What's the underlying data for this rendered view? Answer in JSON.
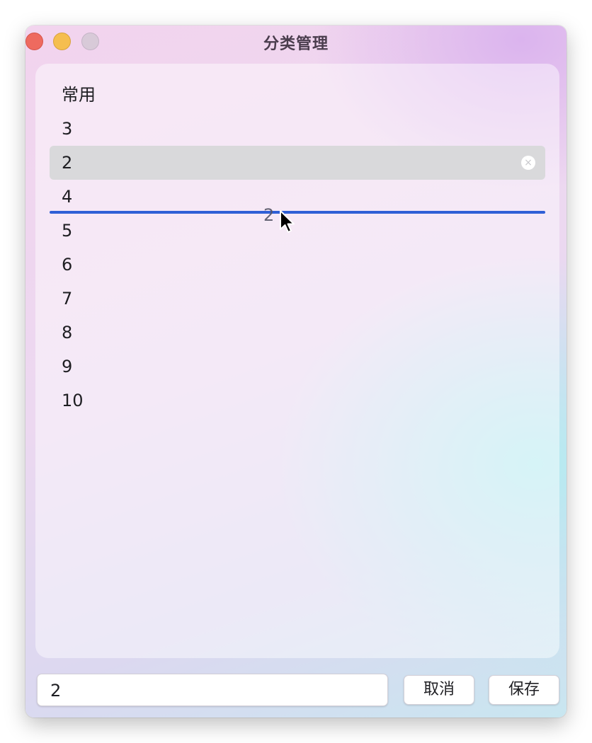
{
  "window": {
    "title": "分类管理"
  },
  "list": {
    "items": [
      {
        "label": "常用"
      },
      {
        "label": "3"
      },
      {
        "label": "2",
        "selected": true
      },
      {
        "label": "4"
      },
      {
        "label": "5"
      },
      {
        "label": "6"
      },
      {
        "label": "7"
      },
      {
        "label": "8"
      },
      {
        "label": "9"
      },
      {
        "label": "10"
      }
    ],
    "drag_ghost_label": "2",
    "clear_icon": "×"
  },
  "footer": {
    "input_value": "2",
    "cancel_label": "取消",
    "save_label": "保存"
  },
  "colors": {
    "drop_indicator": "#2f5fd6",
    "selected_row": "#d9d9db",
    "close": "#ee6a5f",
    "minimize": "#f5be4f",
    "zoom": "#d8cad8"
  }
}
